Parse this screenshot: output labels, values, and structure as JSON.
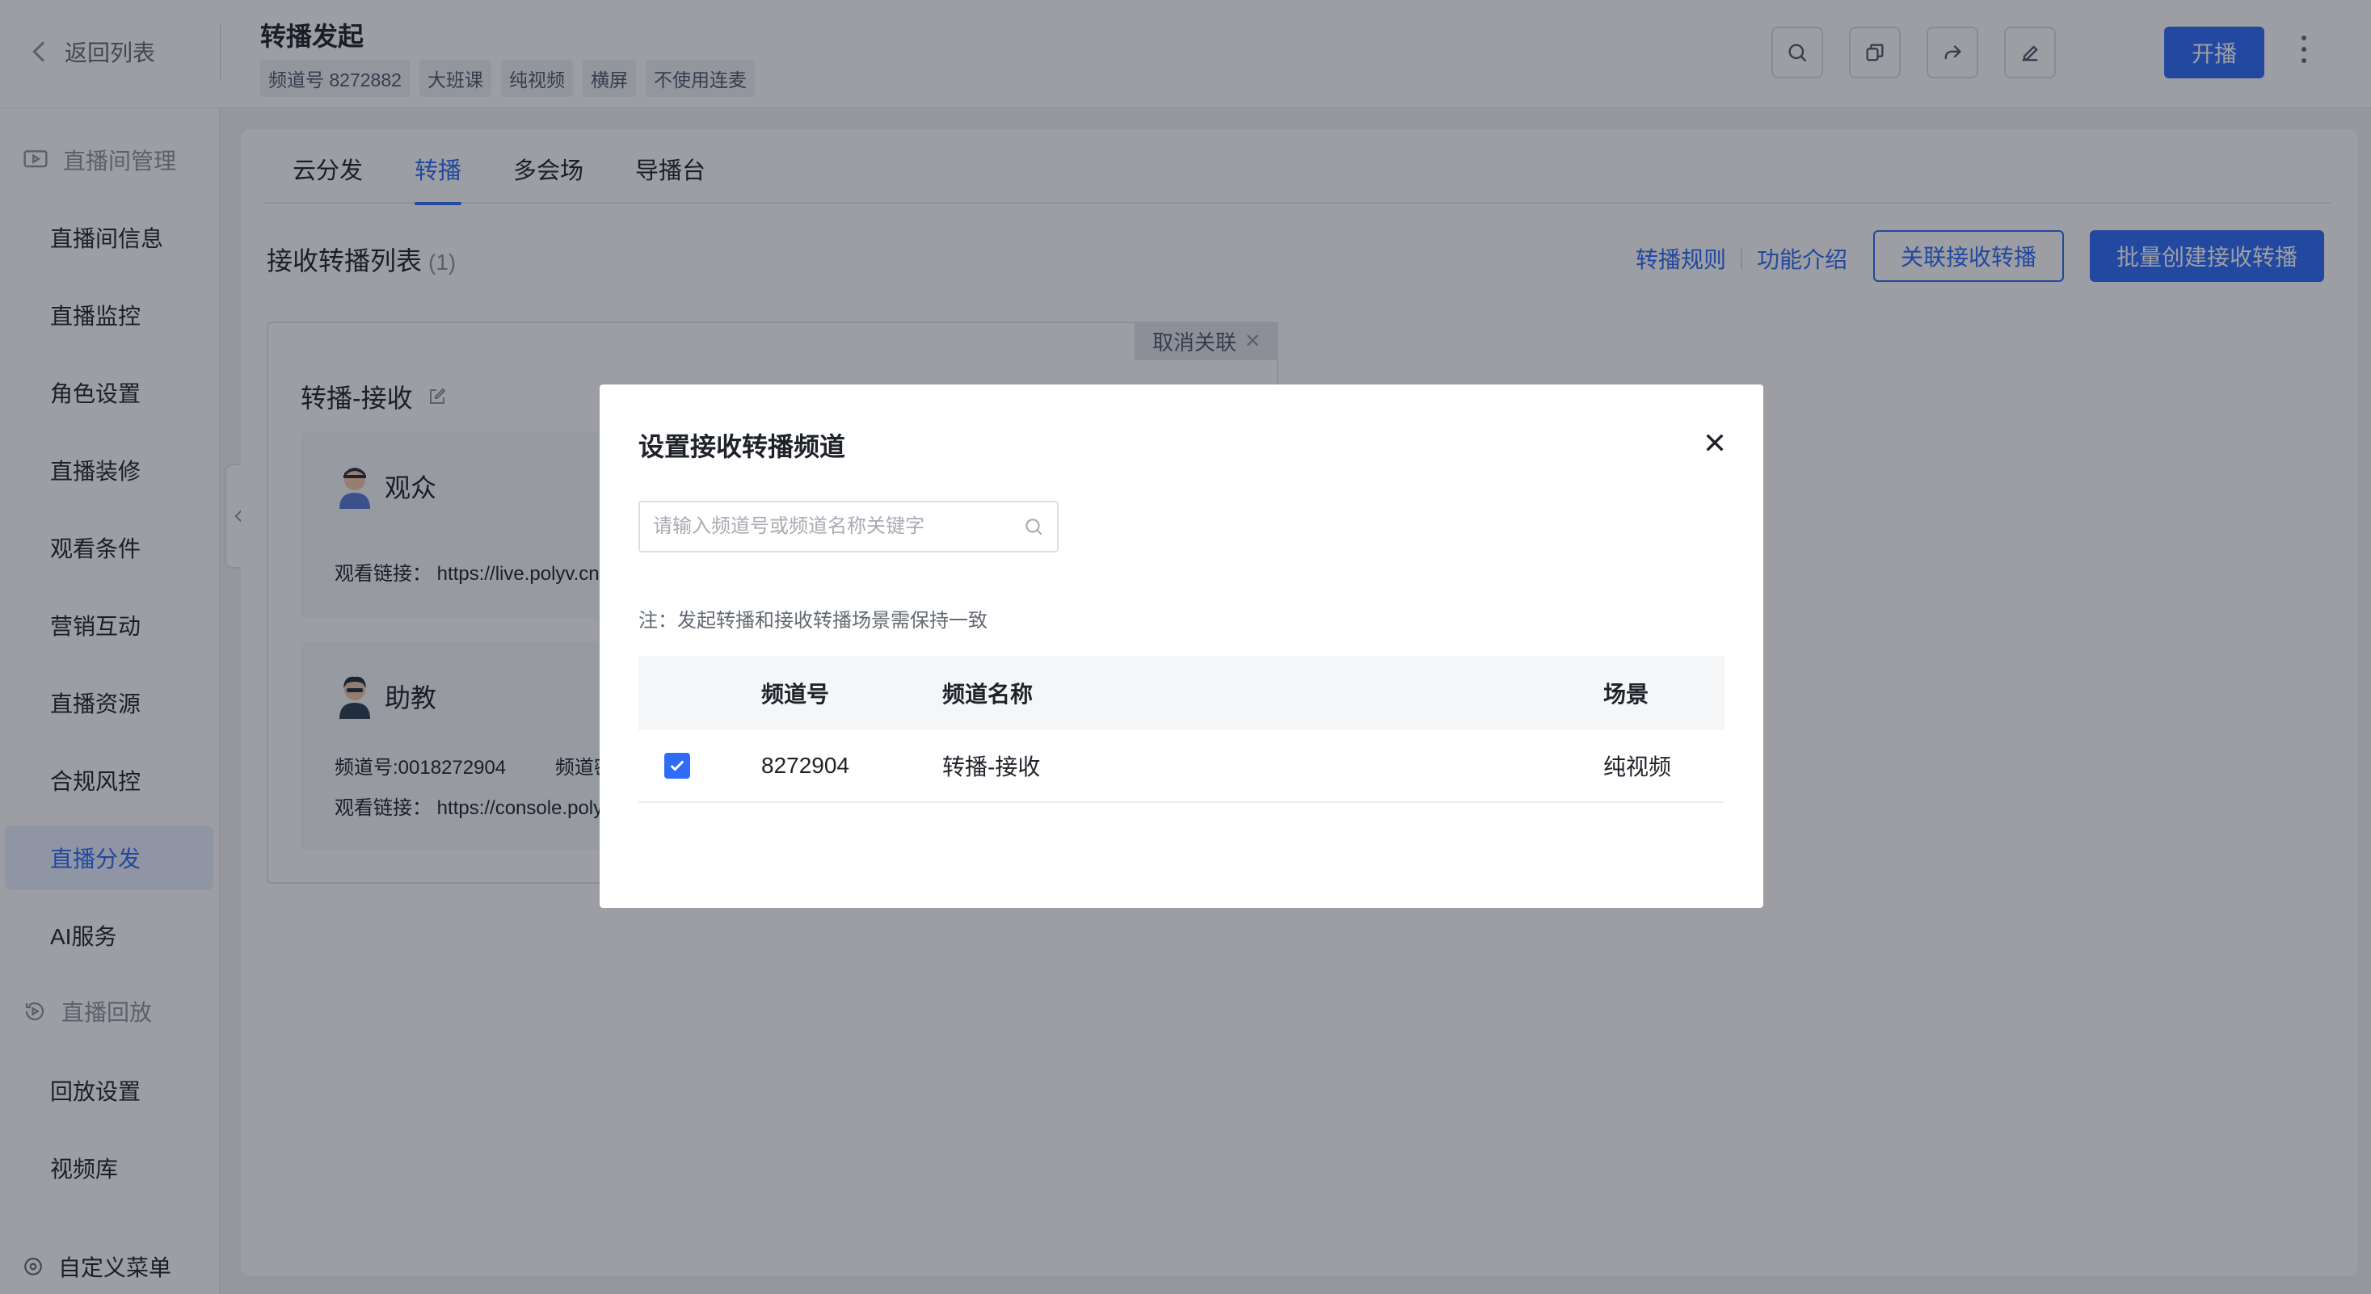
{
  "topbar": {
    "back_label": "返回列表",
    "title": "转播发起",
    "tags": [
      "频道号 8272882",
      "大班课",
      "纯视频",
      "横屏",
      "不使用连麦"
    ],
    "start_label": "开播"
  },
  "sidebar": {
    "group_live": "直播间管理",
    "items": [
      "直播间信息",
      "直播监控",
      "角色设置",
      "直播装修",
      "观看条件",
      "营销互动",
      "直播资源",
      "合规风控",
      "直播分发",
      "AI服务"
    ],
    "group_playback": "直播回放",
    "playback_items": [
      "回放设置",
      "视频库"
    ],
    "footer_label": "自定义菜单",
    "active_item": "直播分发"
  },
  "main": {
    "tabs": [
      "云分发",
      "转播",
      "多会场",
      "导播台"
    ],
    "active_tab": "转播",
    "list_title": "接收转播列表",
    "list_count": "(1)",
    "link_rules": "转播规则",
    "link_intro": "功能介绍",
    "btn_associate": "关联接收转播",
    "btn_batch_create": "批量创建接收转播",
    "card": {
      "unlink_label": "取消关联",
      "title": "转播-接收",
      "audience": {
        "name": "观众",
        "watch_link_label": "观看链接：",
        "watch_link": "https://live.polyv.cn"
      },
      "assistant": {
        "name": "助教",
        "channel_label": "频道号:0018272904",
        "channel_extra": "频道密",
        "watch_link_label": "观看链接：",
        "watch_link": "https://console.poly"
      }
    }
  },
  "modal": {
    "title": "设置接收转播频道",
    "search_placeholder": "请输入频道号或频道名称关键字",
    "note": "注：发起转播和接收转播场景需保持一致",
    "columns": [
      "频道号",
      "频道名称",
      "场景"
    ],
    "rows": [
      {
        "checked": true,
        "channel_no": "8272904",
        "channel_name": "转播-接收",
        "scene": "纯视频"
      }
    ]
  },
  "colors": {
    "accent": "#2e6cf6",
    "overlay": "rgba(18,24,38,0.42)"
  }
}
